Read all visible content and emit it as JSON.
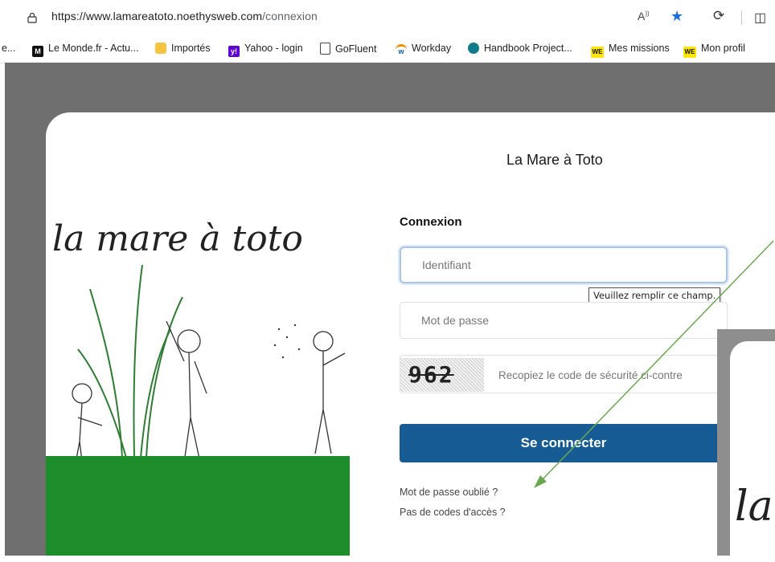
{
  "browser": {
    "url_host": "https://www.lamareatoto.noethysweb.com",
    "url_path": "/connexion",
    "read_aloud": "A¹¹",
    "bookmarks": [
      {
        "label": "e...",
        "icon": "none"
      },
      {
        "label": "Le Monde.fr - Actu...",
        "icon": "lemonde-icon"
      },
      {
        "label": "Importés",
        "icon": "folder-icon"
      },
      {
        "label": "Yahoo - login",
        "icon": "yahoo-icon"
      },
      {
        "label": "GoFluent",
        "icon": "page-icon"
      },
      {
        "label": "Workday",
        "icon": "workday-icon"
      },
      {
        "label": "Handbook Project...",
        "icon": "handbook-icon"
      },
      {
        "label": "Mes missions",
        "icon": "we-icon"
      },
      {
        "label": "Mon profil",
        "icon": "we-icon"
      }
    ]
  },
  "page": {
    "site_title": "La Mare à Toto",
    "logo_text": "la mare à toto",
    "login_heading": "Connexion",
    "username_placeholder": "Identifiant",
    "password_placeholder": "Mot de passe",
    "captcha_code": "962",
    "captcha_placeholder": "Recopiez le code de sécurité ci-contre",
    "submit_label": "Se connecter",
    "forgot_password": "Mot de passe oublié ?",
    "no_access_codes": "Pas de codes d'accès ?",
    "validation_tooltip": "Veuillez remplir ce champ.",
    "overlay_logo_text": "la"
  },
  "colors": {
    "primary_button": "#175b95",
    "annotation_arrow": "#6aa84f",
    "grass": "#1c8d2a"
  }
}
